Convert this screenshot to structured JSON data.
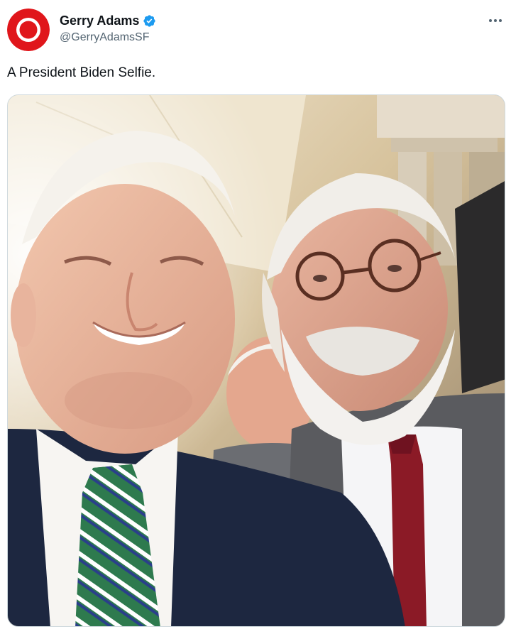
{
  "post": {
    "author": {
      "display_name": "Gerry Adams",
      "handle": "@GerryAdamsSF",
      "verified": true,
      "avatar_icon": "target-logo-icon",
      "avatar_color": "#e0161b"
    },
    "more_icon": "more-horizontal-icon",
    "text": "A President Biden Selfie.",
    "media": {
      "type": "photo",
      "accent_colors": {
        "tie_left_green": "#2e7a4e",
        "tie_right_red": "#8b1a26",
        "suit_navy": "#1d2740"
      }
    }
  },
  "colors": {
    "verified_blue": "#1d9bf0",
    "text_primary": "#0f1419",
    "text_secondary": "#536471"
  }
}
